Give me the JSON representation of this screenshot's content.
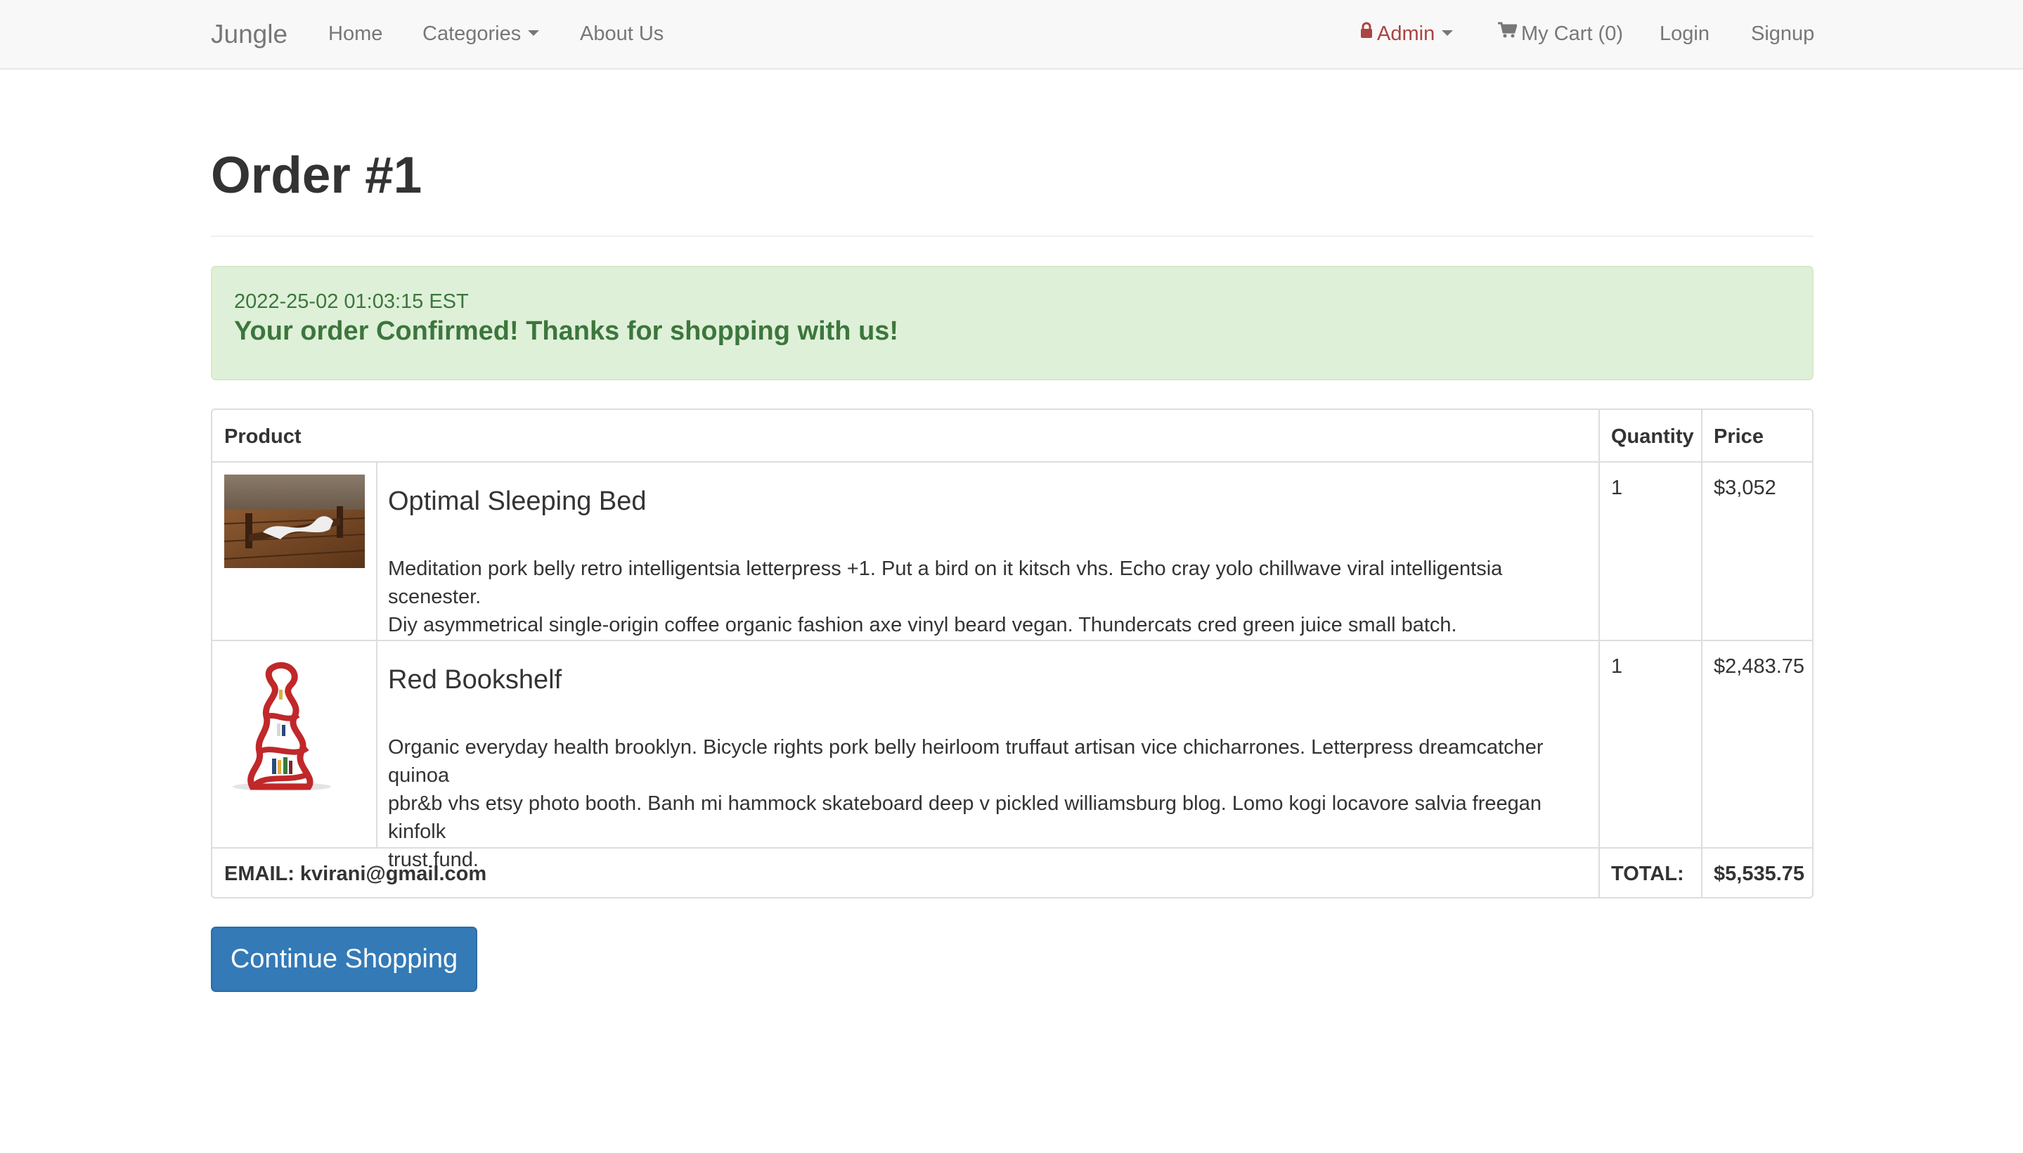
{
  "nav": {
    "brand": "Jungle",
    "home": "Home",
    "categories": "Categories",
    "about": "About Us",
    "admin": "Admin",
    "cart": "My Cart (0)",
    "login": "Login",
    "signup": "Signup",
    "admin_color": "#a94442"
  },
  "order": {
    "title": "Order #1",
    "timestamp": "2022-25-02 01:03:15 EST",
    "confirmation": "Your order Confirmed! Thanks for shopping with us!"
  },
  "table": {
    "headers": {
      "product": "Product",
      "quantity": "Quantity",
      "price": "Price"
    },
    "items": [
      {
        "name": "Optimal Sleeping Bed",
        "description_line1": "Meditation pork belly retro intelligentsia letterpress +1. Put a bird on it kitsch vhs. Echo cray yolo chillwave viral intelligentsia scenester.",
        "description_line2": "Diy asymmetrical single-origin coffee organic fashion axe vinyl beard vegan. Thundercats cred green juice small batch.",
        "quantity": "1",
        "price": "$3,052"
      },
      {
        "name": "Red Bookshelf",
        "description_line1": "Organic everyday health brooklyn. Bicycle rights pork belly heirloom truffaut artisan vice chicharrones. Letterpress dreamcatcher quinoa",
        "description_line2": "pbr&b vhs etsy photo booth. Banh mi hammock skateboard deep v pickled williamsburg blog. Lomo kogi locavore salvia freegan kinfolk",
        "description_line3": "trust fund.",
        "quantity": "1",
        "price": "$2,483.75"
      }
    ],
    "footer": {
      "email": "EMAIL: kvirani@gmail.com",
      "total_label": "TOTAL:",
      "total_value": "$5,535.75"
    }
  },
  "actions": {
    "continue_shopping": "Continue Shopping"
  },
  "colors": {
    "primary": "#337ab7",
    "success_bg": "#dff0d8",
    "success_text": "#3c763d"
  }
}
